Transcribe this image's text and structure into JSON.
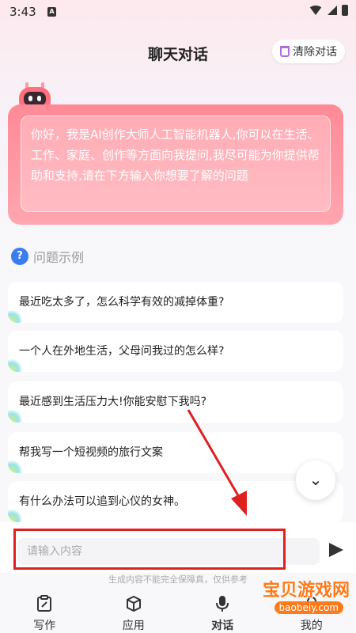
{
  "status_bar": {
    "time": "3:43",
    "sim_letter": "A"
  },
  "header": {
    "title": "聊天对话",
    "clear_label": "清除对话"
  },
  "greeting": "你好，我是AI创作大师人工智能机器人,你可以在生活、工作、家庭、创作等方面向我提问,我尽可能为你提供帮助和支持,请在下方输入你想要了解的问题",
  "examples": {
    "title": "问题示例",
    "items": [
      "最近吃太多了，怎么科学有效的减掉体重?",
      "一个人在外地生活，父母问我过的怎么样?",
      "最近感到生活压力大!你能安慰下我吗?",
      "帮我写一个短视频的旅行文案",
      "有什么办法可以追到心仪的女神。"
    ]
  },
  "input": {
    "placeholder": "请输入内容"
  },
  "disclaimer": "生成内容不能完全保障真，仅供参考",
  "bottom_nav": [
    {
      "label": "写作",
      "icon": "clipboard-edit-icon",
      "active": false
    },
    {
      "label": "应用",
      "icon": "cube-icon",
      "active": false
    },
    {
      "label": "对话",
      "icon": "microphone-icon",
      "active": true
    },
    {
      "label": "我的",
      "icon": "profile-icon",
      "active": false
    }
  ],
  "watermark": {
    "text": "宝贝游戏网",
    "url": "baobeiy.com"
  },
  "colors": {
    "bubble": "#ff8a96",
    "annotation": "#e02020",
    "accent_icon": "#3b7df0"
  }
}
